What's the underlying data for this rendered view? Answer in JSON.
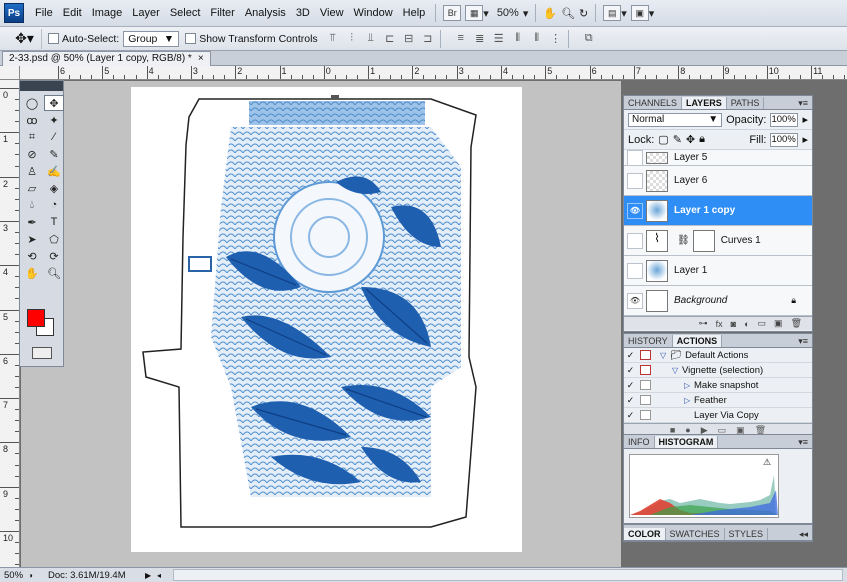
{
  "menubar": {
    "logo": "Ps",
    "items": [
      "File",
      "Edit",
      "Image",
      "Layer",
      "Select",
      "Filter",
      "Analysis",
      "3D",
      "View",
      "Window",
      "Help"
    ],
    "zoom": "50%",
    "br_icon": "Br"
  },
  "options": {
    "auto_select_label": "Auto-Select:",
    "auto_select_value": "Group",
    "show_transform_label": "Show Transform Controls"
  },
  "document": {
    "tab_title": "2-33.psd @ 50% (Layer 1 copy, RGB/8) *",
    "close": "×"
  },
  "ruler": {
    "h_labels": [
      "6",
      "5",
      "4",
      "3",
      "2",
      "1",
      "0",
      "1",
      "2",
      "3",
      "4",
      "5",
      "6",
      "7",
      "8",
      "9",
      "10",
      "11"
    ],
    "v_labels": [
      "0",
      "1",
      "2",
      "3",
      "4",
      "5",
      "6",
      "7",
      "8",
      "9",
      "10",
      "1"
    ]
  },
  "layers_panel": {
    "tabs": [
      "CHANNELS",
      "LAYERS",
      "PATHS"
    ],
    "active_tab": "LAYERS",
    "blend_mode": "Normal",
    "opacity_label": "Opacity:",
    "opacity_value": "100%",
    "lock_label": "Lock:",
    "fill_label": "Fill:",
    "fill_value": "100%",
    "layers": [
      {
        "name": "Layer 5",
        "visible": false,
        "selected": false
      },
      {
        "name": "Layer 6",
        "visible": false,
        "selected": false
      },
      {
        "name": "Layer 1 copy",
        "visible": true,
        "selected": true
      },
      {
        "name": "Curves 1",
        "visible": false,
        "selected": false
      },
      {
        "name": "Layer 1",
        "visible": false,
        "selected": false
      },
      {
        "name": "Background",
        "visible": true,
        "selected": false
      }
    ]
  },
  "history_panel": {
    "tabs": [
      "HISTORY",
      "ACTIONS"
    ],
    "active_tab": "ACTIONS",
    "actions": [
      {
        "label": "Default Actions",
        "level": 0
      },
      {
        "label": "Vignette (selection)",
        "level": 1
      },
      {
        "label": "Make snapshot",
        "level": 2
      },
      {
        "label": "Feather",
        "level": 2
      },
      {
        "label": "Layer Via Copy",
        "level": 2
      }
    ]
  },
  "info_panel": {
    "tabs": [
      "INFO",
      "HISTOGRAM"
    ],
    "active_tab": "HISTOGRAM"
  },
  "color_panel": {
    "tabs": [
      "COLOR",
      "SWATCHES",
      "STYLES"
    ],
    "active_tab": "COLOR"
  },
  "status": {
    "zoom": "50%",
    "doc": "Doc: 3.61M/19.4M"
  },
  "colors": {
    "foreground": "#ff0000",
    "background": "#ffffff",
    "selection": "#2f8ef6"
  }
}
